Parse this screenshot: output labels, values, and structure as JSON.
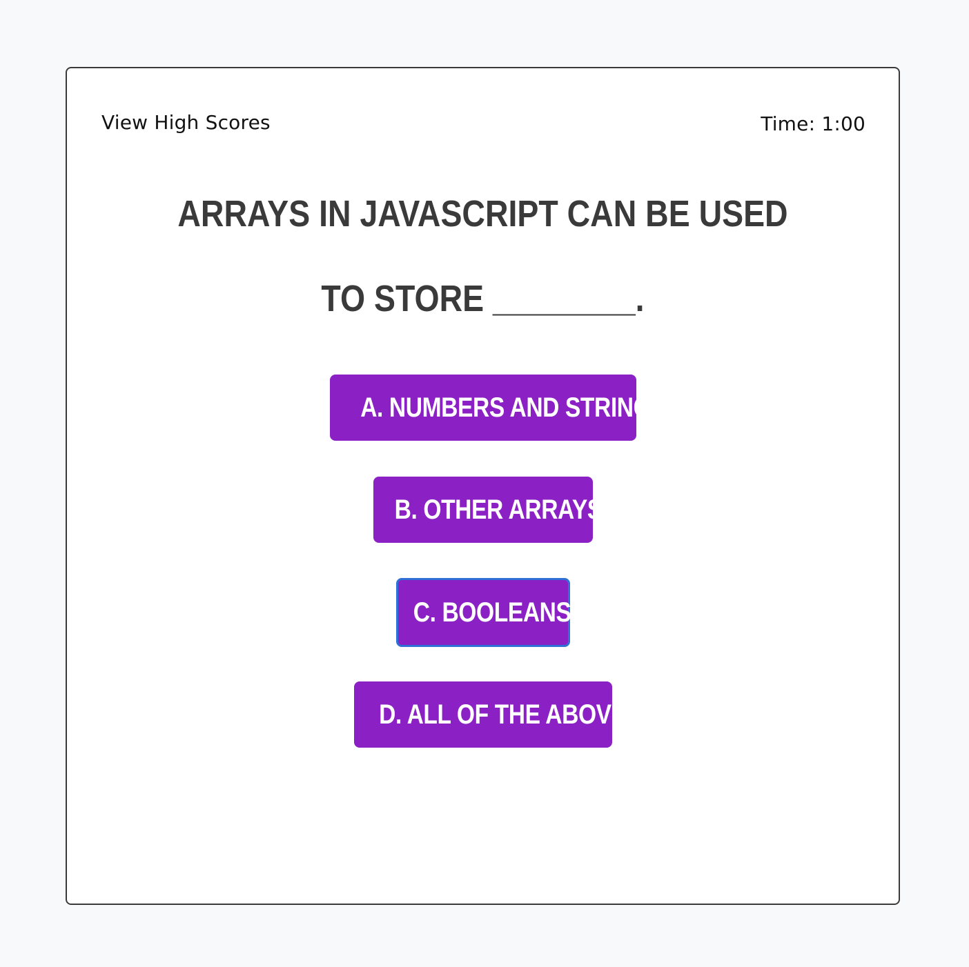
{
  "header": {
    "high_scores_link": "View High Scores",
    "timer": "Time: 1:00"
  },
  "quiz": {
    "question": "Arrays in JavaScript can be used to store ________.",
    "answers": [
      {
        "label": "A. Numbers and Strings"
      },
      {
        "label": "B. Other Arrays"
      },
      {
        "label": "C. Booleans"
      },
      {
        "label": "D. All of the above"
      }
    ]
  },
  "colors": {
    "accent": "#8b21c4",
    "focus_ring": "#2f6fd6",
    "text": "#3a3a3a",
    "background": "#f8f9fb"
  }
}
